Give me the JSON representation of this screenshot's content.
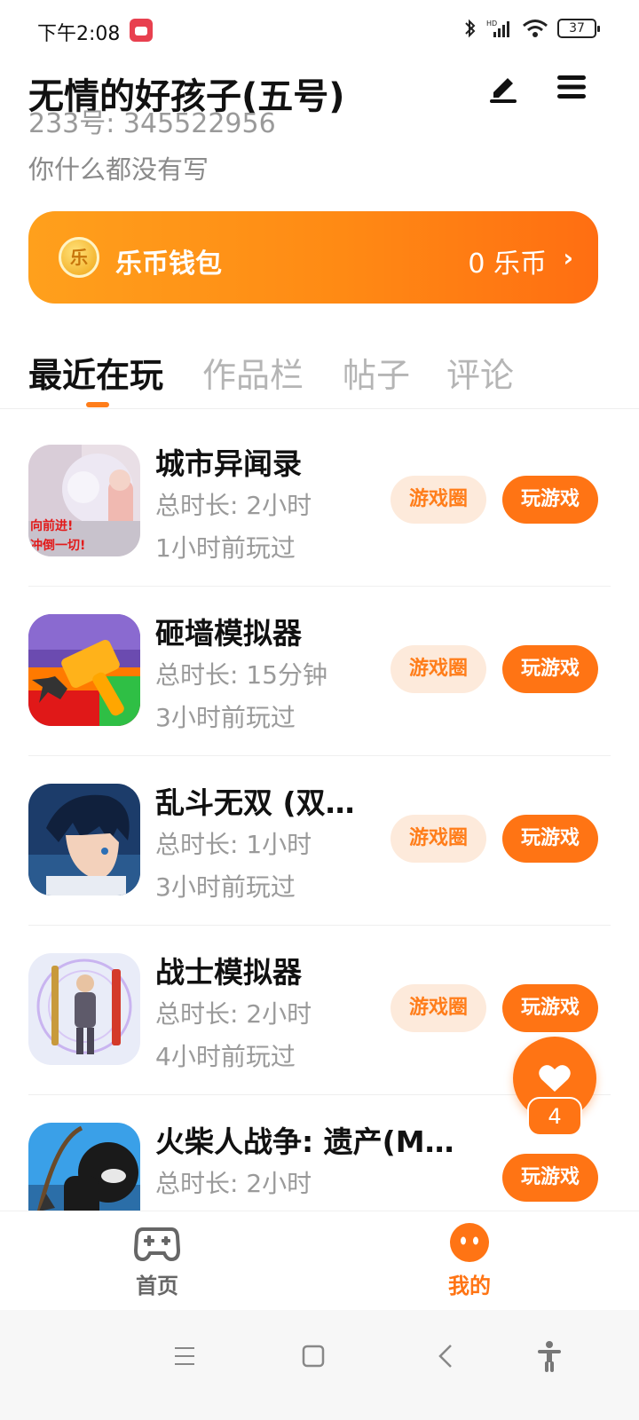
{
  "status_bar": {
    "time": "下午2:08",
    "battery": "37"
  },
  "profile": {
    "nickname": "无情的好孩子(五号)",
    "uid": "233号: 345522956",
    "signature": "你什么都没有写"
  },
  "wallet": {
    "title": "乐币钱包",
    "coin_glyph": "乐",
    "balance": "0 乐币",
    "chevron": "›"
  },
  "tabs": [
    {
      "label": "最近在玩",
      "active": true
    },
    {
      "label": "作品栏",
      "active": false
    },
    {
      "label": "帖子",
      "active": false
    },
    {
      "label": "评论",
      "active": false
    }
  ],
  "games": [
    {
      "name": "城市异闻录",
      "duration": "总时长: 2小时",
      "last_played": "1小时前玩过",
      "circle_label": "游戏圈",
      "play_label": "玩游戏",
      "thumb_text": "向前进!\n冲倒一切!"
    },
    {
      "name": "砸墙模拟器",
      "duration": "总时长: 15分钟",
      "last_played": "3小时前玩过",
      "circle_label": "游戏圈",
      "play_label": "玩游戏"
    },
    {
      "name": "乱斗无双 (双…",
      "duration": "总时长: 1小时",
      "last_played": "3小时前玩过",
      "circle_label": "游戏圈",
      "play_label": "玩游戏"
    },
    {
      "name": "战士模拟器",
      "duration": "总时长: 2小时",
      "last_played": "4小时前玩过",
      "circle_label": "游戏圈",
      "play_label": "玩游戏"
    },
    {
      "name": "火柴人战争: 遗产(M…",
      "duration": "总时长: 2小时",
      "play_label": "玩游戏"
    }
  ],
  "floating_like": {
    "count": "4"
  },
  "bottom_nav": [
    {
      "label": "首页",
      "icon": "gamepad-icon",
      "active": false
    },
    {
      "label": "我的",
      "icon": "face-icon",
      "active": true
    }
  ],
  "colors": {
    "accent": "#ff7414",
    "accent_light": "#fdeadb",
    "wallet_gradient_start": "#ffa01c",
    "wallet_gradient_end": "#ff6e12"
  }
}
